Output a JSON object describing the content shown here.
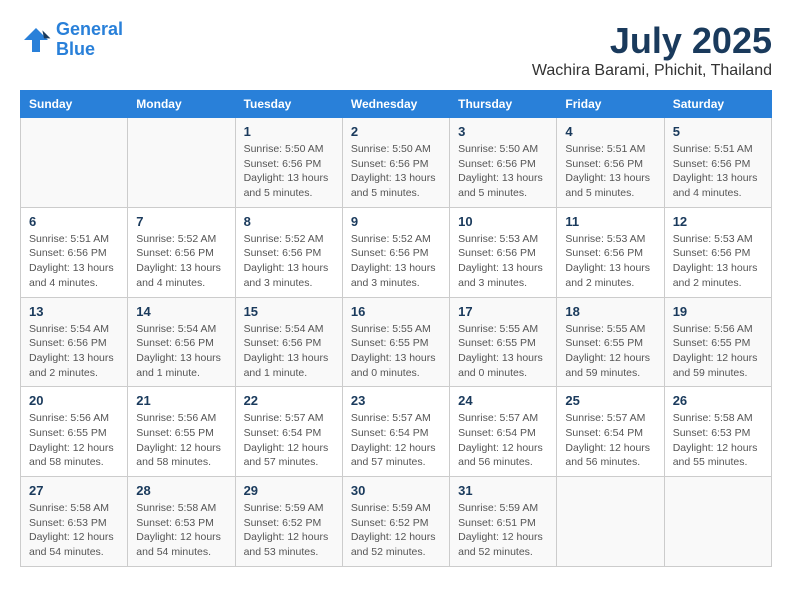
{
  "logo": {
    "line1": "General",
    "line2": "Blue"
  },
  "title": "July 2025",
  "location": "Wachira Barami, Phichit, Thailand",
  "days_of_week": [
    "Sunday",
    "Monday",
    "Tuesday",
    "Wednesday",
    "Thursday",
    "Friday",
    "Saturday"
  ],
  "weeks": [
    [
      {
        "day": "",
        "info": ""
      },
      {
        "day": "",
        "info": ""
      },
      {
        "day": "1",
        "info": "Sunrise: 5:50 AM\nSunset: 6:56 PM\nDaylight: 13 hours and 5 minutes."
      },
      {
        "day": "2",
        "info": "Sunrise: 5:50 AM\nSunset: 6:56 PM\nDaylight: 13 hours and 5 minutes."
      },
      {
        "day": "3",
        "info": "Sunrise: 5:50 AM\nSunset: 6:56 PM\nDaylight: 13 hours and 5 minutes."
      },
      {
        "day": "4",
        "info": "Sunrise: 5:51 AM\nSunset: 6:56 PM\nDaylight: 13 hours and 5 minutes."
      },
      {
        "day": "5",
        "info": "Sunrise: 5:51 AM\nSunset: 6:56 PM\nDaylight: 13 hours and 4 minutes."
      }
    ],
    [
      {
        "day": "6",
        "info": "Sunrise: 5:51 AM\nSunset: 6:56 PM\nDaylight: 13 hours and 4 minutes."
      },
      {
        "day": "7",
        "info": "Sunrise: 5:52 AM\nSunset: 6:56 PM\nDaylight: 13 hours and 4 minutes."
      },
      {
        "day": "8",
        "info": "Sunrise: 5:52 AM\nSunset: 6:56 PM\nDaylight: 13 hours and 3 minutes."
      },
      {
        "day": "9",
        "info": "Sunrise: 5:52 AM\nSunset: 6:56 PM\nDaylight: 13 hours and 3 minutes."
      },
      {
        "day": "10",
        "info": "Sunrise: 5:53 AM\nSunset: 6:56 PM\nDaylight: 13 hours and 3 minutes."
      },
      {
        "day": "11",
        "info": "Sunrise: 5:53 AM\nSunset: 6:56 PM\nDaylight: 13 hours and 2 minutes."
      },
      {
        "day": "12",
        "info": "Sunrise: 5:53 AM\nSunset: 6:56 PM\nDaylight: 13 hours and 2 minutes."
      }
    ],
    [
      {
        "day": "13",
        "info": "Sunrise: 5:54 AM\nSunset: 6:56 PM\nDaylight: 13 hours and 2 minutes."
      },
      {
        "day": "14",
        "info": "Sunrise: 5:54 AM\nSunset: 6:56 PM\nDaylight: 13 hours and 1 minute."
      },
      {
        "day": "15",
        "info": "Sunrise: 5:54 AM\nSunset: 6:56 PM\nDaylight: 13 hours and 1 minute."
      },
      {
        "day": "16",
        "info": "Sunrise: 5:55 AM\nSunset: 6:55 PM\nDaylight: 13 hours and 0 minutes."
      },
      {
        "day": "17",
        "info": "Sunrise: 5:55 AM\nSunset: 6:55 PM\nDaylight: 13 hours and 0 minutes."
      },
      {
        "day": "18",
        "info": "Sunrise: 5:55 AM\nSunset: 6:55 PM\nDaylight: 12 hours and 59 minutes."
      },
      {
        "day": "19",
        "info": "Sunrise: 5:56 AM\nSunset: 6:55 PM\nDaylight: 12 hours and 59 minutes."
      }
    ],
    [
      {
        "day": "20",
        "info": "Sunrise: 5:56 AM\nSunset: 6:55 PM\nDaylight: 12 hours and 58 minutes."
      },
      {
        "day": "21",
        "info": "Sunrise: 5:56 AM\nSunset: 6:55 PM\nDaylight: 12 hours and 58 minutes."
      },
      {
        "day": "22",
        "info": "Sunrise: 5:57 AM\nSunset: 6:54 PM\nDaylight: 12 hours and 57 minutes."
      },
      {
        "day": "23",
        "info": "Sunrise: 5:57 AM\nSunset: 6:54 PM\nDaylight: 12 hours and 57 minutes."
      },
      {
        "day": "24",
        "info": "Sunrise: 5:57 AM\nSunset: 6:54 PM\nDaylight: 12 hours and 56 minutes."
      },
      {
        "day": "25",
        "info": "Sunrise: 5:57 AM\nSunset: 6:54 PM\nDaylight: 12 hours and 56 minutes."
      },
      {
        "day": "26",
        "info": "Sunrise: 5:58 AM\nSunset: 6:53 PM\nDaylight: 12 hours and 55 minutes."
      }
    ],
    [
      {
        "day": "27",
        "info": "Sunrise: 5:58 AM\nSunset: 6:53 PM\nDaylight: 12 hours and 54 minutes."
      },
      {
        "day": "28",
        "info": "Sunrise: 5:58 AM\nSunset: 6:53 PM\nDaylight: 12 hours and 54 minutes."
      },
      {
        "day": "29",
        "info": "Sunrise: 5:59 AM\nSunset: 6:52 PM\nDaylight: 12 hours and 53 minutes."
      },
      {
        "day": "30",
        "info": "Sunrise: 5:59 AM\nSunset: 6:52 PM\nDaylight: 12 hours and 52 minutes."
      },
      {
        "day": "31",
        "info": "Sunrise: 5:59 AM\nSunset: 6:51 PM\nDaylight: 12 hours and 52 minutes."
      },
      {
        "day": "",
        "info": ""
      },
      {
        "day": "",
        "info": ""
      }
    ]
  ]
}
